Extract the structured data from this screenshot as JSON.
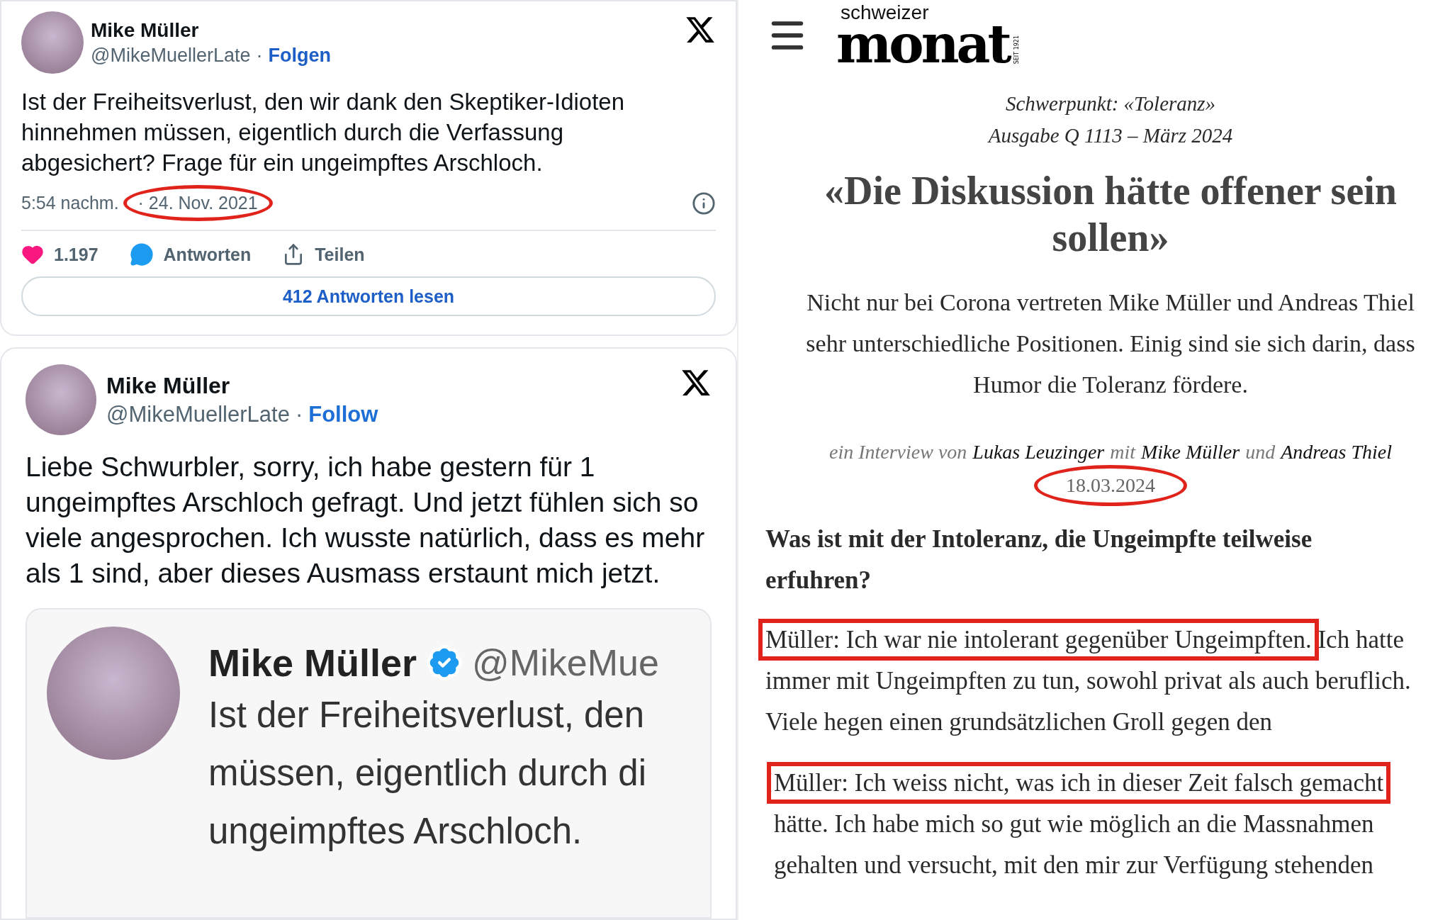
{
  "tweets": [
    {
      "author": "Mike Müller",
      "handle": "@MikeMuellerLate",
      "separator": "·",
      "follow_label": "Folgen",
      "text": "Ist der Freiheitsverlust, den wir dank den Skeptiker-Idioten hinnehmen müssen, eigentlich durch die Verfassung abgesichert? Frage für ein ungeimpftes Arschloch.",
      "time": "5:54 nachm.",
      "date": "· 24. Nov. 2021",
      "date_circled": true,
      "likes": "1.197",
      "reply_label": "Antworten",
      "share_label": "Teilen",
      "read_replies": "412 Antworten lesen",
      "kind": "standard"
    },
    {
      "author": "Mike Müller",
      "handle": "@MikeMuellerLate",
      "separator": "·",
      "follow_label": "Follow",
      "text": "Liebe Schwurbler, sorry, ich habe gestern für 1 ungeimpftes Arschloch gefragt. Und jetzt fühlen sich so viele angesprochen. Ich wusste natürlich, dass es mehr als 1 sind, aber dieses Ausmass erstaunt mich jetzt.",
      "kind": "quote",
      "quoted_image": {
        "author": "Mike Müller",
        "verified": true,
        "handle": "@MikeMue",
        "lines": [
          "Ist der Freiheitsverlust, den",
          "müssen, eigentlich durch di",
          "ungeimpftes Arschloch."
        ]
      }
    }
  ],
  "article": {
    "logo": {
      "top": "schweizer",
      "main": "monat",
      "since": "SEIT 1921"
    },
    "kicker": "Schwerpunkt: «Toleranz»",
    "issue": "Ausgabe Q 1113 – März 2024",
    "headline": "«Die Diskussion hätte offener sein sollen»",
    "lead": "Nicht nur bei Corona vertreten Mike Müller und Andreas Thiel sehr unterschiedliche Positionen. Einig sind sie sich darin, dass Humor die Toleranz fördere.",
    "byline": [
      {
        "text": "ein Interview von",
        "kind": "muted"
      },
      {
        "text": "Lukas Leuzinger",
        "kind": "name"
      },
      {
        "text": "mit",
        "kind": "muted"
      },
      {
        "text": "Mike Müller",
        "kind": "name"
      },
      {
        "text": "und",
        "kind": "muted"
      },
      {
        "text": "Andreas Thiel",
        "kind": "name"
      }
    ],
    "date": "18.03.2024",
    "date_circled": true,
    "question": "Was ist mit der Intoleranz, die Ungeimpfte teilweise erfuhren?",
    "answers": [
      {
        "highlighted": "Müller: Ich war nie intolerant gegenüber Ungeimpften.",
        "rest": "Ich hatte immer mit Ungeimpften zu tun, sowohl privat als auch beruflich. Viele hegen einen grundsätzlichen Groll gegen den"
      },
      {
        "highlighted": "Müller: Ich weiss nicht, was ich in dieser Zeit falsch gemacht",
        "rest": "hätte. Ich habe mich so gut wie möglich an die Massnahmen gehalten und versucht, mit den mir zur Verfügung stehenden"
      }
    ]
  }
}
